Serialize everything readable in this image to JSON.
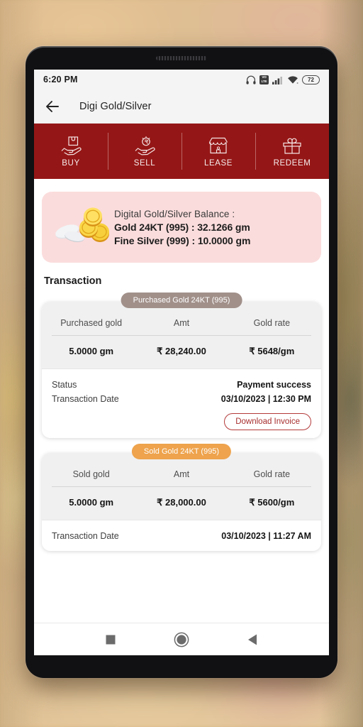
{
  "status_bar": {
    "time": "6:20 PM",
    "icons": [
      "headphones-icon",
      "volte-icon",
      "signal-icon",
      "wifi-icon",
      "battery-icon"
    ],
    "volte_top": "VO",
    "volte_bottom": "LTE",
    "battery_level": "72"
  },
  "app_bar": {
    "back_icon": "back-arrow-icon",
    "title": "Digi Gold/Silver"
  },
  "tabs": [
    {
      "label": "BUY",
      "icon": "hand-box-icon"
    },
    {
      "label": "SELL",
      "icon": "hand-rupee-coin-icon"
    },
    {
      "label": "LEASE",
      "icon": "shop-icon"
    },
    {
      "label": "REDEEM",
      "icon": "gift-icon"
    }
  ],
  "balance": {
    "icon": "gold-silver-coins-icon",
    "title": "Digital Gold/Silver Balance :",
    "gold": "Gold 24KT (995) : 32.1266 gm",
    "silver": "Fine Silver (999) : 10.0000 gm"
  },
  "section": {
    "title": "Transaction"
  },
  "transactions": [
    {
      "badge": "Purchased Gold 24KT (995)",
      "badge_style": "purchased",
      "headers": [
        "Purchased gold",
        "Amt",
        "Gold rate"
      ],
      "values": [
        "5.0000 gm",
        "₹ 28,240.00",
        "₹ 5648/gm"
      ],
      "details": [
        {
          "key": "Status",
          "value": "Payment success"
        },
        {
          "key": "Transaction Date",
          "value": "03/10/2023 | 12:30 PM"
        }
      ],
      "action_label": "Download Invoice"
    },
    {
      "badge": "Sold Gold 24KT (995)",
      "badge_style": "sold",
      "headers": [
        "Sold gold",
        "Amt",
        "Gold rate"
      ],
      "values": [
        "5.0000 gm",
        "₹ 28,000.00",
        "₹ 5600/gm"
      ],
      "details": [
        {
          "key": "Transaction Date",
          "value": "03/10/2023 | 11:27 AM"
        }
      ],
      "action_label": null
    }
  ],
  "nav_bar": {
    "recents": "square-recents-icon",
    "home": "circle-home-icon",
    "back": "triangle-back-icon"
  },
  "colors": {
    "tab_red": "#951616",
    "balance_pink": "#fbdcdc",
    "badge_purchased": "#a1908a",
    "badge_sold": "#eea34c",
    "invoice_red": "#a72d2d"
  }
}
